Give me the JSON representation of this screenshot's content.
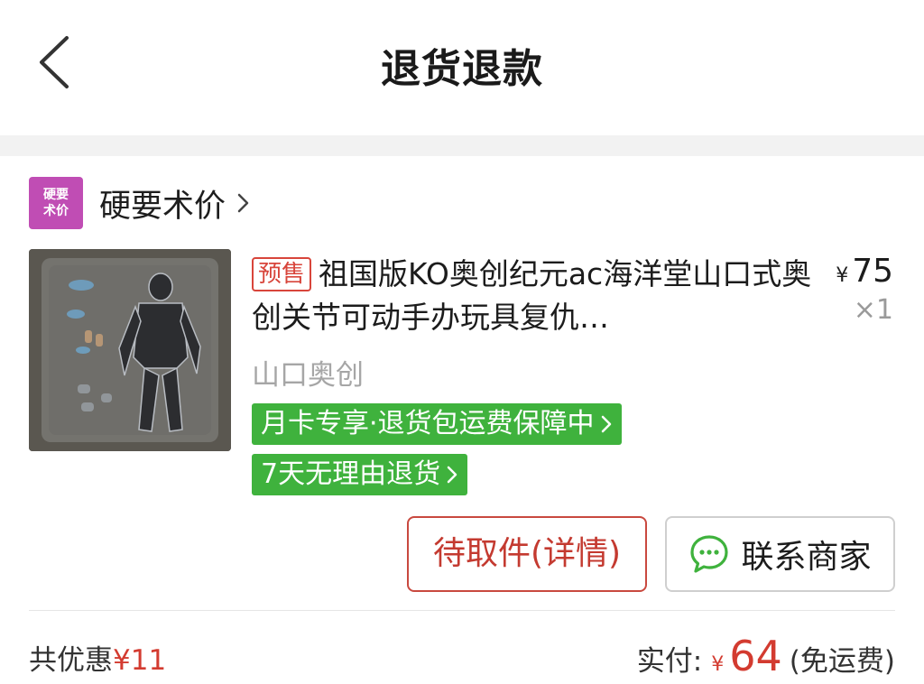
{
  "nav": {
    "title": "退货退款"
  },
  "shop": {
    "logo_line1": "硬要",
    "logo_line2": "术价",
    "name": "硬要术价"
  },
  "product": {
    "badge": "预售",
    "title": "祖国版KO奥创纪元ac海洋堂山口式奥创关节可动手办玩具复仇…",
    "price_currency": "¥",
    "price": "75",
    "quantity": "×1",
    "spec": "山口奥创",
    "tags": [
      "月卡专享·退货包运费保障中",
      "7天无理由退货"
    ]
  },
  "actions": {
    "detail": "待取件(详情)",
    "contact": "联系商家"
  },
  "summary": {
    "discount_label": "共优惠",
    "discount_amount": "¥11",
    "paid_label": "实付:",
    "paid_currency": "¥",
    "paid_amount": "64",
    "shipping_note": "(免运费)"
  },
  "colors": {
    "accent": "#d33b30",
    "tag_green": "#3fb23d",
    "shop_logo": "#c04db4"
  },
  "icons": [
    "back-arrow-icon",
    "chevron-right-icon",
    "chat-bubble-icon"
  ]
}
